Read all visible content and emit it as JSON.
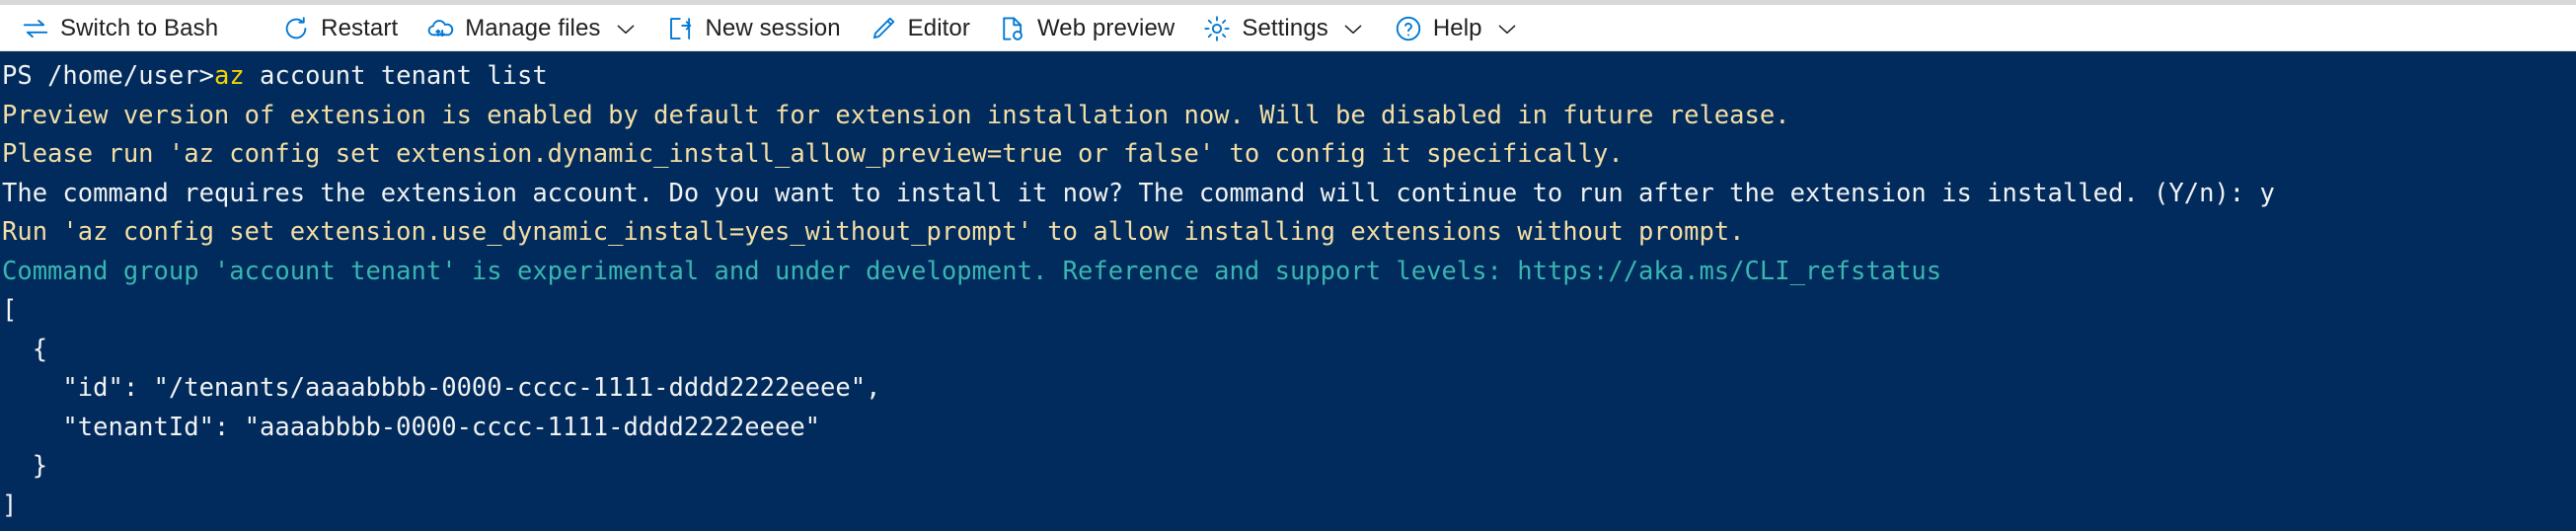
{
  "window": {
    "app_name": "Azure Cloud Shell",
    "accent_color": "#0078d4",
    "terminal_bg": "#002b5c",
    "terminal_fg": "#f2f2f2",
    "warning_color": "#f5dea4",
    "experimental_color": "#3ab5b0",
    "command_color": "#f6d400"
  },
  "toolbar": {
    "items": [
      {
        "id": "switch-to-bash",
        "label": "Switch to Bash",
        "icon": "switch-arrows-icon",
        "has_caret": false
      },
      {
        "id": "restart",
        "label": "Restart",
        "icon": "restart-icon",
        "has_caret": false
      },
      {
        "id": "manage-files",
        "label": "Manage files",
        "icon": "cloud-upload-icon",
        "has_caret": true
      },
      {
        "id": "new-session",
        "label": "New session",
        "icon": "new-session-icon",
        "has_caret": false
      },
      {
        "id": "editor",
        "label": "Editor",
        "icon": "pencil-icon",
        "has_caret": false
      },
      {
        "id": "web-preview",
        "label": "Web preview",
        "icon": "web-preview-icon",
        "has_caret": false
      },
      {
        "id": "settings",
        "label": "Settings",
        "icon": "gear-icon",
        "has_caret": true
      },
      {
        "id": "help",
        "label": "Help",
        "icon": "help-circle-icon",
        "has_caret": true
      }
    ]
  },
  "terminal": {
    "prompt": {
      "shell": "PS",
      "path": "/home/user>",
      "command_head": "az",
      "command_tail": " account tenant list"
    },
    "lines": [
      {
        "id": "warn-preview-version",
        "color": "warning",
        "text": "Preview version of extension is enabled by default for extension installation now. Will be disabled in future release."
      },
      {
        "id": "warn-config-preview",
        "color": "warning",
        "text": "Please run 'az config set extension.dynamic_install_allow_preview=true or false' to config it specifically."
      },
      {
        "id": "prompt-install-extension",
        "color": "white",
        "text": "The command requires the extension account. Do you want to install it now? The command will continue to run after the extension is installed. (Y/n): y"
      },
      {
        "id": "warn-use-dynamic-install",
        "color": "warning",
        "text": "Run 'az config set extension.use_dynamic_install=yes_without_prompt' to allow installing extensions without prompt."
      },
      {
        "id": "note-experimental",
        "color": "cyan",
        "text": "Command group 'account tenant' is experimental and under development. Reference and support levels: https://aka.ms/CLI_refstatus"
      },
      {
        "id": "json-open-bracket",
        "color": "white",
        "text": "["
      },
      {
        "id": "json-open-brace",
        "color": "white",
        "text": "  {"
      },
      {
        "id": "json-id",
        "color": "white",
        "text": "    \"id\": \"/tenants/aaaabbbb-0000-cccc-1111-dddd2222eeee\","
      },
      {
        "id": "json-tenant-id",
        "color": "white",
        "text": "    \"tenantId\": \"aaaabbbb-0000-cccc-1111-dddd2222eeee\""
      },
      {
        "id": "json-close-brace",
        "color": "white",
        "text": "  }"
      },
      {
        "id": "json-close-bracket",
        "color": "white",
        "text": "]"
      }
    ]
  }
}
